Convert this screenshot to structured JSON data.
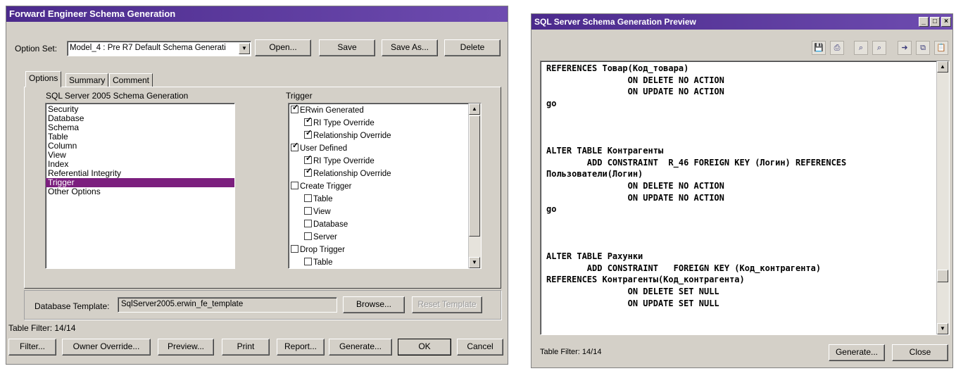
{
  "left_window": {
    "title": "Forward Engineer Schema Generation",
    "option_set_label": "Option Set:",
    "option_set_value": "Model_4 : Pre R7 Default Schema Generati",
    "buttons": {
      "open": "Open...",
      "save": "Save",
      "save_as": "Save As...",
      "delete": "Delete"
    },
    "tabs": [
      "Options",
      "Summary",
      "Comment"
    ],
    "schema_heading": "SQL Server 2005 Schema Generation",
    "trigger_heading": "Trigger",
    "categories": [
      "Security",
      "Database",
      "Schema",
      "Table",
      "Column",
      "View",
      "Index",
      "Referential Integrity",
      "Trigger",
      "Other Options"
    ],
    "selected_category": "Trigger",
    "trigger_items": [
      {
        "label": "ERwin Generated",
        "checked": true,
        "indent": 0
      },
      {
        "label": "RI Type Override",
        "checked": true,
        "indent": 1
      },
      {
        "label": "Relationship Override",
        "checked": true,
        "indent": 1
      },
      {
        "label": "User Defined",
        "checked": true,
        "indent": 0
      },
      {
        "label": "RI Type Override",
        "checked": true,
        "indent": 1
      },
      {
        "label": "Relationship Override",
        "checked": true,
        "indent": 1
      },
      {
        "label": "Create Trigger",
        "checked": false,
        "indent": 0
      },
      {
        "label": "Table",
        "checked": false,
        "indent": 1
      },
      {
        "label": "View",
        "checked": false,
        "indent": 1
      },
      {
        "label": "Database",
        "checked": false,
        "indent": 1
      },
      {
        "label": "Server",
        "checked": false,
        "indent": 1
      },
      {
        "label": "Drop Trigger",
        "checked": false,
        "indent": 0
      },
      {
        "label": "Table",
        "checked": false,
        "indent": 1
      }
    ],
    "db_template_label": "Database Template:",
    "db_template_value": "SqlServer2005.erwin_fe_template",
    "browse_label": "Browse...",
    "reset_template_label": "Reset Template",
    "table_filter": "Table Filter: 14/14",
    "bottom_buttons": {
      "filter": "Filter...",
      "owner_override": "Owner Override...",
      "preview": "Preview...",
      "print": "Print",
      "report": "Report...",
      "generate": "Generate...",
      "ok": "OK",
      "cancel": "Cancel"
    }
  },
  "right_window": {
    "title": "SQL Server Schema Generation Preview",
    "toolbar_icons": [
      "save-icon",
      "print-icon",
      "find-icon",
      "find-next-icon",
      "goto-icon",
      "copy-icon",
      "paste-icon"
    ],
    "code_lines": [
      "REFERENCES Товар(Код_товара)",
      "                ON DELETE NO ACTION",
      "                ON UPDATE NO ACTION",
      "go",
      "",
      "",
      "",
      "ALTER TABLE Контрагенты",
      "        ADD CONSTRAINT  R_46 FOREIGN KEY (Логин) REFERENCES",
      "Пользователи(Логин)",
      "                ON DELETE NO ACTION",
      "                ON UPDATE NO ACTION",
      "go",
      "",
      "",
      "",
      "ALTER TABLE Рахунки",
      "        ADD CONSTRAINT   FOREIGN KEY (Код_контрагента)",
      "REFERENCES Контрагенты(Код_контрагента)",
      "                ON DELETE SET NULL",
      "                ON UPDATE SET NULL"
    ],
    "table_filter": "Table Filter: 14/14",
    "generate_label": "Generate...",
    "close_label": "Close"
  },
  "colors": {
    "title_bar": "#4b2a8c",
    "selection": "#7b1f7e",
    "dialog_bg": "#d4d0c8"
  }
}
